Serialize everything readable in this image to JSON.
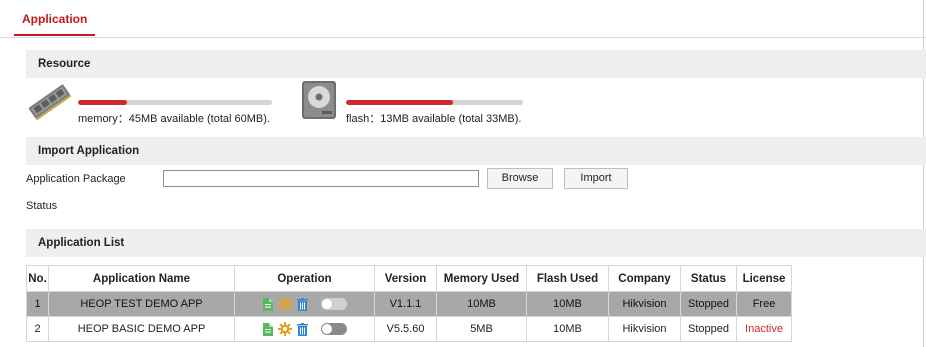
{
  "tabs": [
    {
      "label": "Application",
      "active": true
    }
  ],
  "resource": {
    "title": "Resource",
    "memory": {
      "text": "memory：45MB available (total 60MB).",
      "used_fraction": 0.25,
      "icon": "memory-module-icon"
    },
    "flash": {
      "text": "flash：13MB available (total 33MB).",
      "used_fraction": 0.606,
      "icon": "hard-disk-icon"
    }
  },
  "import": {
    "title": "Import Application",
    "package_label": "Application Package",
    "package_value": "",
    "browse_label": "Browse",
    "import_label": "Import",
    "status_label": "Status"
  },
  "app_list": {
    "title": "Application List",
    "headers": [
      "No.",
      "Application Name",
      "Operation",
      "Version",
      "Memory Used",
      "Flash Used",
      "Company",
      "Status",
      "License"
    ],
    "rows": [
      {
        "no": "1",
        "name": "HEOP TEST DEMO APP",
        "version": "V1.1.1",
        "memory_used": "10MB",
        "flash_used": "10MB",
        "company": "Hikvision",
        "status": "Stopped",
        "license": "Free",
        "selected": true,
        "enabled": false
      },
      {
        "no": "2",
        "name": "HEOP BASIC DEMO APP",
        "version": "V5.5.60",
        "memory_used": "5MB",
        "flash_used": "10MB",
        "company": "Hikvision",
        "status": "Stopped",
        "license": "Inactive",
        "selected": false,
        "enabled": false
      }
    ],
    "operation_icons": [
      "document-icon",
      "gear-icon",
      "trash-icon",
      "toggle-switch"
    ]
  },
  "colors": {
    "accent": "#c41a1a",
    "bar_fill": "#d1282b",
    "bar_track": "#d4d4d4",
    "section_bg": "#efefef",
    "selected_row": "#a8a8a8",
    "doc_icon": "#5cb85c",
    "gear_icon": "#e8a020",
    "trash_icon": "#2f86d6"
  }
}
